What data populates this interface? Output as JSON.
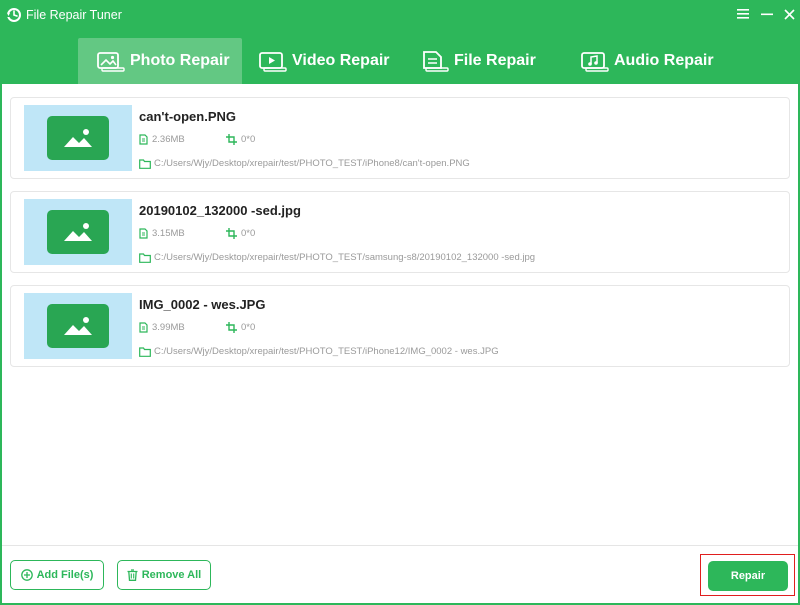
{
  "window": {
    "title": "File Repair Tuner",
    "icons": {
      "logo": "refresh-logo-icon",
      "menu": "hamburger-menu-icon",
      "minimize": "minimize-icon",
      "close": "close-icon"
    }
  },
  "tabs": [
    {
      "label": "Photo Repair",
      "icon": "photo-icon",
      "active": true
    },
    {
      "label": "Video Repair",
      "icon": "video-icon",
      "active": false
    },
    {
      "label": "File Repair",
      "icon": "document-icon",
      "active": false
    },
    {
      "label": "Audio Repair",
      "icon": "audio-icon",
      "active": false
    }
  ],
  "files": [
    {
      "name": "can't-open.PNG",
      "size": "2.36MB",
      "resolution": "0*0",
      "path": "C:/Users/Wjy/Desktop/xrepair/test/PHOTO_TEST/iPhone8/can't-open.PNG"
    },
    {
      "name": "20190102_132000 -sed.jpg",
      "size": "3.15MB",
      "resolution": "0*0",
      "path": "C:/Users/Wjy/Desktop/xrepair/test/PHOTO_TEST/samsung-s8/20190102_132000 -sed.jpg"
    },
    {
      "name": "IMG_0002 - wes.JPG",
      "size": "3.99MB",
      "resolution": "0*0",
      "path": "C:/Users/Wjy/Desktop/xrepair/test/PHOTO_TEST/iPhone12/IMG_0002 - wes.JPG"
    }
  ],
  "footer": {
    "add_label": "Add File(s)",
    "remove_label": "Remove All",
    "repair_label": "Repair"
  },
  "colors": {
    "accent": "#2db75a",
    "active_tab": "#63c883",
    "thumb_bg": "#bfe6f7",
    "highlight": "#e01e1e"
  }
}
